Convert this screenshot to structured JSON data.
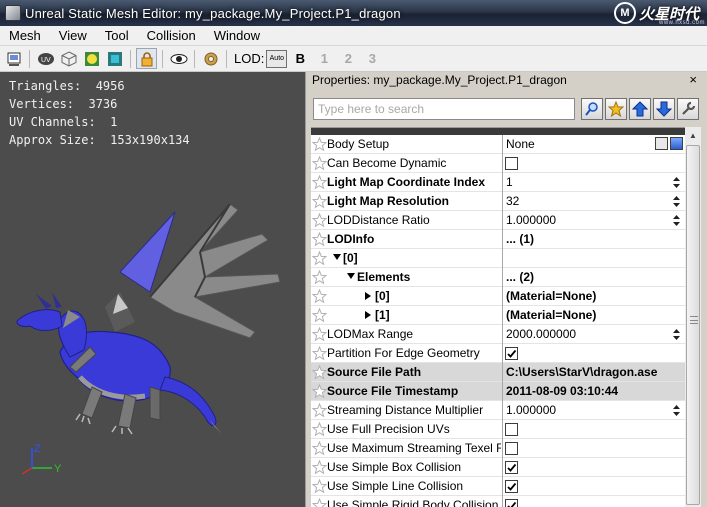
{
  "window": {
    "title": "Unreal Static Mesh Editor: my_package.My_Project.P1_dragon",
    "watermark": {
      "mark": "M",
      "text": "火星时代",
      "url": "www.hxsd.com"
    }
  },
  "menu": [
    "Mesh",
    "View",
    "Tool",
    "Collision",
    "Window"
  ],
  "toolbar": {
    "icons": [
      "wireframe-toggle-icon",
      "uv-icon",
      "cube-outline-icon",
      "sphere-cube-icon",
      "box-cube-icon",
      "lock-icon",
      "eye-icon",
      "gear-icon"
    ],
    "lod_label": "LOD:",
    "lod_auto": "Auto",
    "lod_levels": [
      "B",
      "1",
      "2",
      "3"
    ]
  },
  "viewport": {
    "stats": [
      "Triangles:  4956",
      "Vertices:  3736",
      "UV Channels:  1",
      "Approx Size:  153x190x134"
    ],
    "axes": {
      "z": "Z",
      "y": "Y",
      "x_color": "#d03030",
      "y_color": "#30c030",
      "z_color": "#3050ff"
    },
    "background": "#4c4c4c",
    "mesh_color": "#3a3ad8"
  },
  "properties": {
    "title": "Properties: my_package.My_Project.P1_dragon",
    "close": "×",
    "search_placeholder": "Type here to search",
    "search_tools": [
      "find-icon",
      "star-icon",
      "arrow-up-icon",
      "arrow-down-icon",
      "wrench-icon"
    ],
    "rows": [
      {
        "name": "Body Setup",
        "value": "None",
        "type": "text",
        "bold": false,
        "indent": 0,
        "extra": true
      },
      {
        "name": "Can Become Dynamic",
        "value": "",
        "type": "checkbox",
        "checked": false,
        "bold": false,
        "indent": 0
      },
      {
        "name": "Light Map Coordinate Index",
        "value": "1",
        "type": "spin",
        "bold": true,
        "indent": 0
      },
      {
        "name": "Light Map Resolution",
        "value": "32",
        "type": "spin",
        "bold": true,
        "indent": 0
      },
      {
        "name": "LODDistance Ratio",
        "value": "1.000000",
        "type": "spin",
        "bold": false,
        "indent": 0
      },
      {
        "name": "LODInfo",
        "value": "... (1)",
        "type": "text",
        "bold": true,
        "valbold": true,
        "indent": 0
      },
      {
        "name": "[0]",
        "value": "",
        "type": "text",
        "bold": true,
        "indent": 1,
        "expander": "down"
      },
      {
        "name": "Elements",
        "value": "... (2)",
        "type": "text",
        "bold": true,
        "valbold": true,
        "indent": 2,
        "expander": "down"
      },
      {
        "name": "[0]",
        "value": "(Material=None)",
        "type": "text",
        "bold": true,
        "valbold": true,
        "indent": 3,
        "expander": "right"
      },
      {
        "name": "[1]",
        "value": "(Material=None)",
        "type": "text",
        "bold": true,
        "valbold": true,
        "indent": 3,
        "expander": "right"
      },
      {
        "name": "LODMax Range",
        "value": "2000.000000",
        "type": "spin",
        "bold": false,
        "indent": 0
      },
      {
        "name": "Partition For Edge Geometry",
        "value": "",
        "type": "checkbox",
        "checked": true,
        "bold": false,
        "indent": 0
      },
      {
        "name": "Source File Path",
        "value": "C:\\Users\\StarV\\dragon.ase",
        "type": "text",
        "bold": true,
        "valbold": true,
        "indent": 0,
        "highlight": true
      },
      {
        "name": "Source File Timestamp",
        "value": "2011-08-09 03:10:44",
        "type": "text",
        "bold": true,
        "valbold": true,
        "indent": 0,
        "highlight": true
      },
      {
        "name": "Streaming Distance Multiplier",
        "value": "1.000000",
        "type": "spin",
        "bold": false,
        "indent": 0
      },
      {
        "name": "Use Full Precision UVs",
        "value": "",
        "type": "checkbox",
        "checked": false,
        "bold": false,
        "indent": 0
      },
      {
        "name": "Use Maximum Streaming Texel R",
        "value": "",
        "type": "checkbox",
        "checked": false,
        "bold": false,
        "indent": 0
      },
      {
        "name": "Use Simple Box Collision",
        "value": "",
        "type": "checkbox",
        "checked": true,
        "bold": false,
        "indent": 0
      },
      {
        "name": "Use Simple Line Collision",
        "value": "",
        "type": "checkbox",
        "checked": true,
        "bold": false,
        "indent": 0
      },
      {
        "name": "Use Simple Rigid Body Collision",
        "value": "",
        "type": "checkbox",
        "checked": true,
        "bold": false,
        "indent": 0
      }
    ]
  }
}
